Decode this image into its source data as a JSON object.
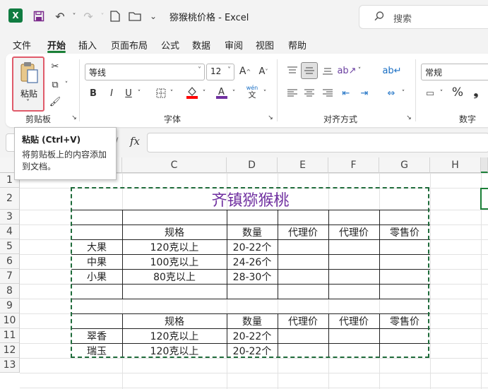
{
  "titlebar": {
    "logo": "X",
    "doc_title": "猕猴桃价格  -  Excel",
    "search_placeholder": "搜索"
  },
  "menu": [
    "文件",
    "开始",
    "插入",
    "页面布局",
    "公式",
    "数据",
    "审阅",
    "视图",
    "帮助"
  ],
  "ribbon": {
    "paste_label": "粘贴",
    "clipboard_group": "剪贴板",
    "font_name": "等线",
    "font_size": "12",
    "font_group": "字体",
    "alignment_group": "对齐方式",
    "number_format": "常规",
    "number_group": "数字",
    "bold": "B",
    "italic": "I",
    "underline": "U",
    "grow_font": "A^",
    "shrink_font": "A˅",
    "percent": "%",
    "comma": "❟",
    "phonetic_top": "wén",
    "phonetic_bottom": "文"
  },
  "tooltip": {
    "title": "粘贴 (Ctrl+V)",
    "body": "将剪贴板上的内容添加到文档。"
  },
  "formula_bar": {
    "fx": "fx"
  },
  "columns": [
    "C",
    "D",
    "E",
    "F",
    "G",
    "H"
  ],
  "rows": [
    "1",
    "2",
    "3",
    "4",
    "5",
    "6",
    "7",
    "8",
    "9",
    "10",
    "11",
    "12",
    "13"
  ],
  "sheet": {
    "title": "齐镇猕猴桃",
    "header1": {
      "spec": "规格",
      "qty": "数量",
      "agent1": "代理价",
      "agent2": "代理价",
      "retail": "零售价"
    },
    "block1": [
      {
        "name": "大果",
        "spec": "120克以上",
        "qty": "20-22个"
      },
      {
        "name": "中果",
        "spec": "100克以上",
        "qty": "24-26个"
      },
      {
        "name": "小果",
        "spec": "80克以上",
        "qty": "28-30个"
      }
    ],
    "header2": {
      "spec": "规格",
      "qty": "数量",
      "agent1": "代理价",
      "agent2": "代理价",
      "retail": "零售价"
    },
    "block2": [
      {
        "name": "翠香",
        "spec": "120克以上",
        "qty": "20-22个"
      },
      {
        "name": "瑞玉",
        "spec": "120克以上",
        "qty": "20-22个"
      }
    ]
  },
  "colors": {
    "accent": "#1a7f37",
    "title_purple": "#7030a0",
    "excel_green": "#107c41",
    "marquee": "#1e6b3a"
  }
}
